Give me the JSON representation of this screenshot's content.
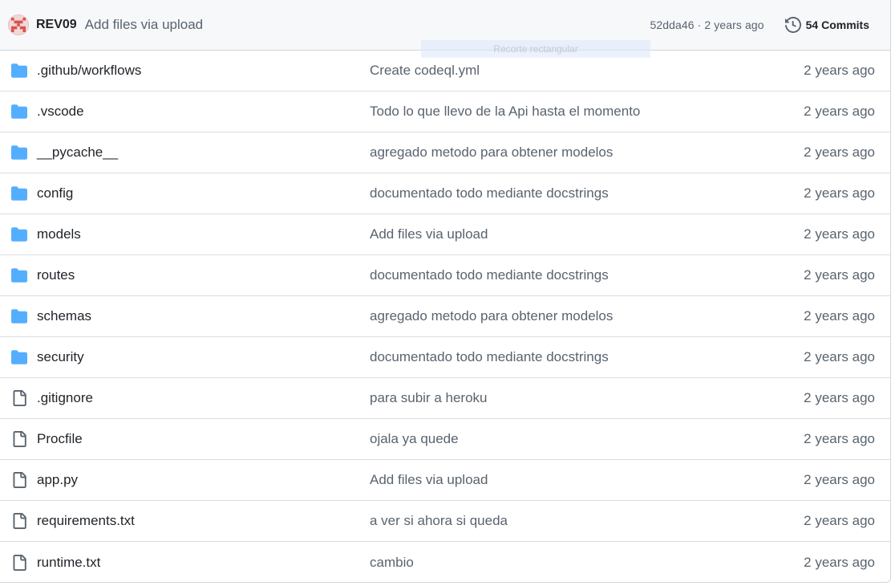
{
  "latest_commit": {
    "author": "REV09",
    "message": "Add files via upload",
    "meta": "52dda46 · 2 years ago",
    "commits_label": "54 Commits",
    "overlay_text": "Recorte rectangular"
  },
  "files": [
    {
      "name": ".github/workflows",
      "type": "folder",
      "message": "Create codeql.yml",
      "age": "2 years ago"
    },
    {
      "name": ".vscode",
      "type": "folder",
      "message": "Todo lo que llevo de la Api hasta el momento",
      "age": "2 years ago"
    },
    {
      "name": "__pycache__",
      "type": "folder",
      "message": "agregado metodo para obtener modelos",
      "age": "2 years ago"
    },
    {
      "name": "config",
      "type": "folder",
      "message": "documentado todo mediante docstrings",
      "age": "2 years ago"
    },
    {
      "name": "models",
      "type": "folder",
      "message": "Add files via upload",
      "age": "2 years ago"
    },
    {
      "name": "routes",
      "type": "folder",
      "message": "documentado todo mediante docstrings",
      "age": "2 years ago"
    },
    {
      "name": "schemas",
      "type": "folder",
      "message": "agregado metodo para obtener modelos",
      "age": "2 years ago"
    },
    {
      "name": "security",
      "type": "folder",
      "message": "documentado todo mediante docstrings",
      "age": "2 years ago"
    },
    {
      "name": ".gitignore",
      "type": "file",
      "message": "para subir a heroku",
      "age": "2 years ago"
    },
    {
      "name": "Procfile",
      "type": "file",
      "message": "ojala ya quede",
      "age": "2 years ago"
    },
    {
      "name": "app.py",
      "type": "file",
      "message": "Add files via upload",
      "age": "2 years ago"
    },
    {
      "name": "requirements.txt",
      "type": "file",
      "message": "a ver si ahora si queda",
      "age": "2 years ago"
    },
    {
      "name": "runtime.txt",
      "type": "file",
      "message": "cambio",
      "age": "2 years ago"
    }
  ],
  "icons": {
    "folder": "folder-icon",
    "file": "file-icon",
    "history": "history-icon",
    "avatar": "identicon-avatar"
  },
  "colors": {
    "folder": "#54aeff",
    "file_icon": "#59636e",
    "avatar": "#d9534f",
    "header_bg": "#f6f8fa",
    "border": "#d0d7de"
  }
}
